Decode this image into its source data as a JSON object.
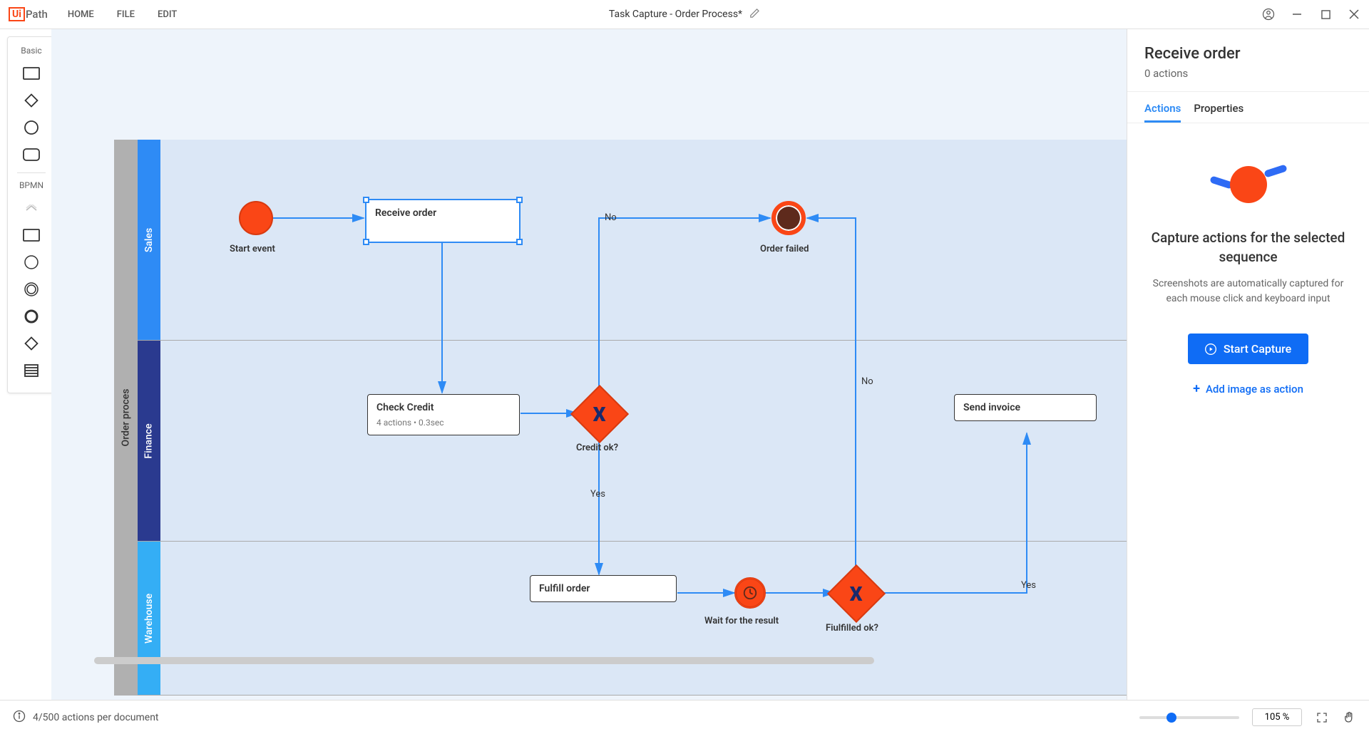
{
  "app": {
    "logo_prefix": "Ui",
    "logo_suffix": "Path",
    "menu": [
      "HOME",
      "FILE",
      "EDIT"
    ],
    "title": "Task Capture - Order Process*"
  },
  "toolbox": {
    "group1_label": "Basic",
    "group2_label": "BPMN"
  },
  "pool": {
    "title": "Order proces",
    "lanes": {
      "sales": "Sales",
      "finance": "Finance",
      "warehouse": "Warehouse"
    }
  },
  "nodes": {
    "start_event_label": "Start event",
    "receive_order": "Receive order",
    "order_failed": "Order failed",
    "check_credit": {
      "title": "Check Credit",
      "sub": "4 actions  •  0.3sec"
    },
    "credit_ok": "Credit ok?",
    "send_invoice": "Send invoice",
    "fulfill_order": "Fulfill order",
    "wait_result": "Wait for the result",
    "fulfilled_ok": "Fiulfilled ok?"
  },
  "edges": {
    "no1": "No",
    "no2": "No",
    "yes1": "Yes",
    "yes2": "Yes"
  },
  "right_panel": {
    "title": "Receive order",
    "subtitle": "0 actions",
    "tabs": {
      "actions": "Actions",
      "properties": "Properties"
    },
    "msg_title": "Capture actions for the selected sequence",
    "msg_body": "Screenshots are automatically captured for each mouse click and keyboard input",
    "btn_start": "Start Capture",
    "link_add_image": "Add image as action"
  },
  "status_bar": {
    "left": "4/500 actions per document",
    "zoom_value": "105 %"
  }
}
